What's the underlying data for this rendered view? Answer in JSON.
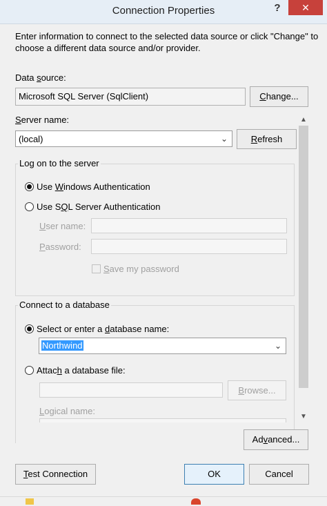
{
  "window": {
    "title": "Connection Properties",
    "help_symbol": "?",
    "close_symbol": "✕"
  },
  "description": "Enter information to connect to the selected data source or click \"Change\" to choose a different data source and/or provider.",
  "data_source": {
    "label_prefix": "Data ",
    "label_underlined": "s",
    "label_suffix": "ource:",
    "value": "Microsoft SQL Server (SqlClient)",
    "change_button": {
      "underlined": "C",
      "rest": "hange..."
    }
  },
  "server": {
    "label_underlined": "S",
    "label_suffix": "erver name:",
    "value": "(local)",
    "refresh_button": {
      "underlined": "R",
      "rest": "efresh"
    }
  },
  "logon": {
    "group_title": "Log on to the server",
    "windows_auth": {
      "prefix": "Use ",
      "underlined": "W",
      "suffix": "indows Authentication",
      "selected": true
    },
    "sql_auth": {
      "prefix": "Use S",
      "underlined": "Q",
      "suffix": "L Server Authentication",
      "selected": false
    },
    "user_name": {
      "underlined": "U",
      "suffix": "ser name:"
    },
    "password": {
      "underlined": "P",
      "suffix": "assword:"
    },
    "save_password": {
      "underlined": "S",
      "suffix": "ave my password",
      "checked": false
    }
  },
  "database": {
    "group_title": "Connect to a database",
    "select_option": {
      "prefix": "Select or enter a ",
      "underlined": "d",
      "suffix": "atabase name:",
      "selected": true
    },
    "database_name": "Northwind",
    "attach_option": {
      "prefix": "Attac",
      "underlined": "h",
      "suffix": " a database file:",
      "selected": false
    },
    "browse_button": {
      "underlined": "B",
      "rest": "rowse..."
    },
    "logical_name": {
      "underlined": "L",
      "suffix": "ogical name:"
    }
  },
  "buttons": {
    "advanced": {
      "prefix": "Ad",
      "underlined": "v",
      "suffix": "anced..."
    },
    "test_connection": {
      "underlined": "T",
      "suffix": "est Connection"
    },
    "ok": "OK",
    "cancel": "Cancel"
  },
  "icons": {
    "chevron_down": "⌄",
    "scroll_up": "▲",
    "scroll_down": "▼"
  },
  "colors": {
    "titlebar": "#e6eef6",
    "close_button": "#c7413b",
    "selection": "#3399ff",
    "dialog_background": "#f0f0f0"
  }
}
